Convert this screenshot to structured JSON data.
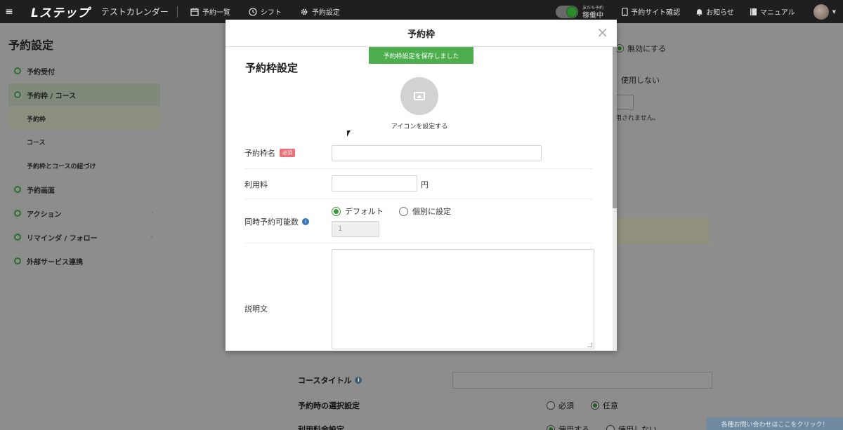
{
  "topbar": {
    "menu_icon": "≡",
    "logo": "Lステップ",
    "calendar_name": "テストカレンダー",
    "nav": [
      {
        "icon": "calendar-icon",
        "label": "予約一覧"
      },
      {
        "icon": "clock-icon",
        "label": "シフト"
      },
      {
        "icon": "gear-icon",
        "label": "予約設定"
      }
    ],
    "toggle_small": "友だち予約",
    "toggle_status": "稼働中",
    "links": [
      {
        "icon": "phone-icon",
        "label": "予約サイト確認"
      },
      {
        "icon": "bell-icon",
        "label": "お知らせ"
      },
      {
        "icon": "book-icon",
        "label": "マニュアル"
      }
    ]
  },
  "sidebar": {
    "title": "予約設定",
    "items": [
      {
        "label": "予約受付"
      },
      {
        "label": "予約枠 / コース"
      },
      {
        "label": "予約枠"
      },
      {
        "label": "コース"
      },
      {
        "label": "予約枠とコースの紐づけ"
      },
      {
        "label": "予約画面"
      },
      {
        "label": "アクション"
      },
      {
        "label": "リマインダ / フォロー"
      },
      {
        "label": "外部サービス連携"
      }
    ]
  },
  "background": {
    "radio_disable": "無効にする",
    "radio_unused": "使用しない",
    "note_fragment": "用されません。",
    "course_title_label": "コースタイトル",
    "select_setting_label": "予約時の選択設定",
    "select_required": "必須",
    "select_optional": "任意",
    "fee_setting_label": "利用料金設定",
    "fee_use": "使用する",
    "fee_unused": "使用しない",
    "help_button": "各種お問い合わせはここをクリック！"
  },
  "modal": {
    "title": "予約枠",
    "close": "×",
    "toast": "予約枠設定を保存しました",
    "section_title": "予約枠設定",
    "icon_label": "アイコンを設定する",
    "name_label": "予約枠名",
    "required_badge": "必須",
    "fee_label": "利用料",
    "fee_unit": "円",
    "concurrent_label": "同時予約可能数",
    "radio_default": "デフォルト",
    "radio_individual": "個別に設定",
    "concurrent_value": "1",
    "description_label": "説明文"
  }
}
